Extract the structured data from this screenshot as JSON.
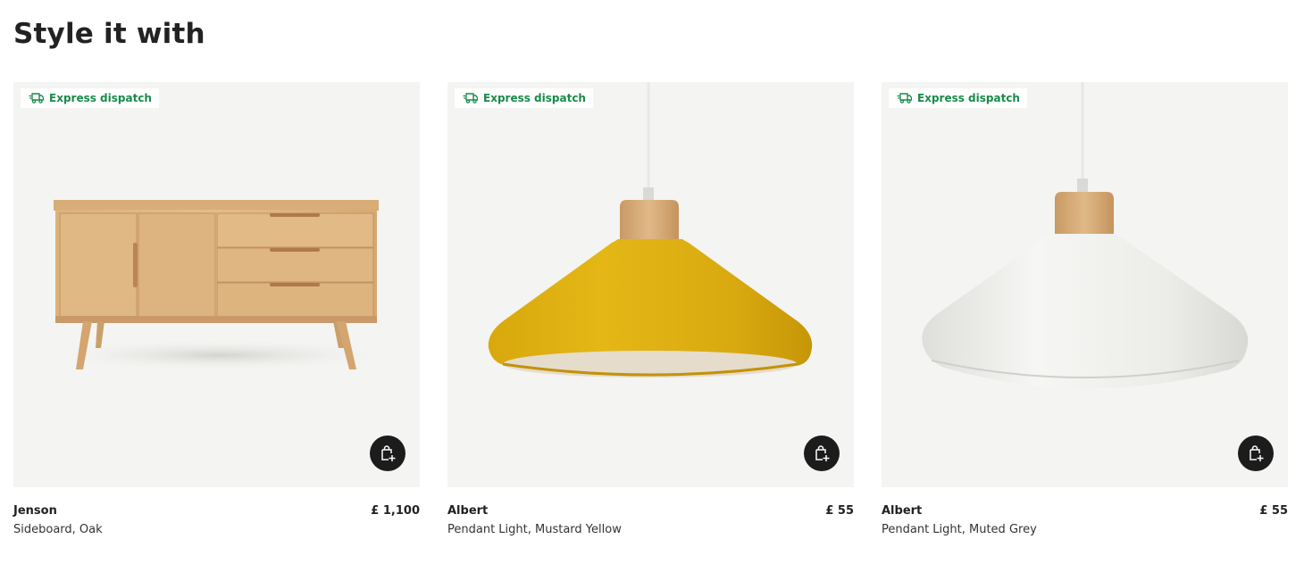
{
  "section": {
    "title": "Style it with"
  },
  "colors": {
    "badge_green": "#1a8a4a",
    "image_bg": "#f4f4f2",
    "cart_button": "#1c1c1c"
  },
  "products": [
    {
      "badge": "Express dispatch",
      "badge_icon": "truck-icon",
      "name": "Jenson",
      "price": "£ 1,100",
      "description": "Sideboard, Oak",
      "image": "oak-sideboard",
      "cart_icon": "add-to-bag-icon"
    },
    {
      "badge": "Express dispatch",
      "badge_icon": "truck-icon",
      "name": "Albert",
      "price": "£ 55",
      "description": "Pendant Light, Mustard Yellow",
      "image": "mustard-pendant-light",
      "cart_icon": "add-to-bag-icon"
    },
    {
      "badge": "Express dispatch",
      "badge_icon": "truck-icon",
      "name": "Albert",
      "price": "£ 55",
      "description": "Pendant Light, Muted Grey",
      "image": "grey-pendant-light",
      "cart_icon": "add-to-bag-icon"
    }
  ]
}
